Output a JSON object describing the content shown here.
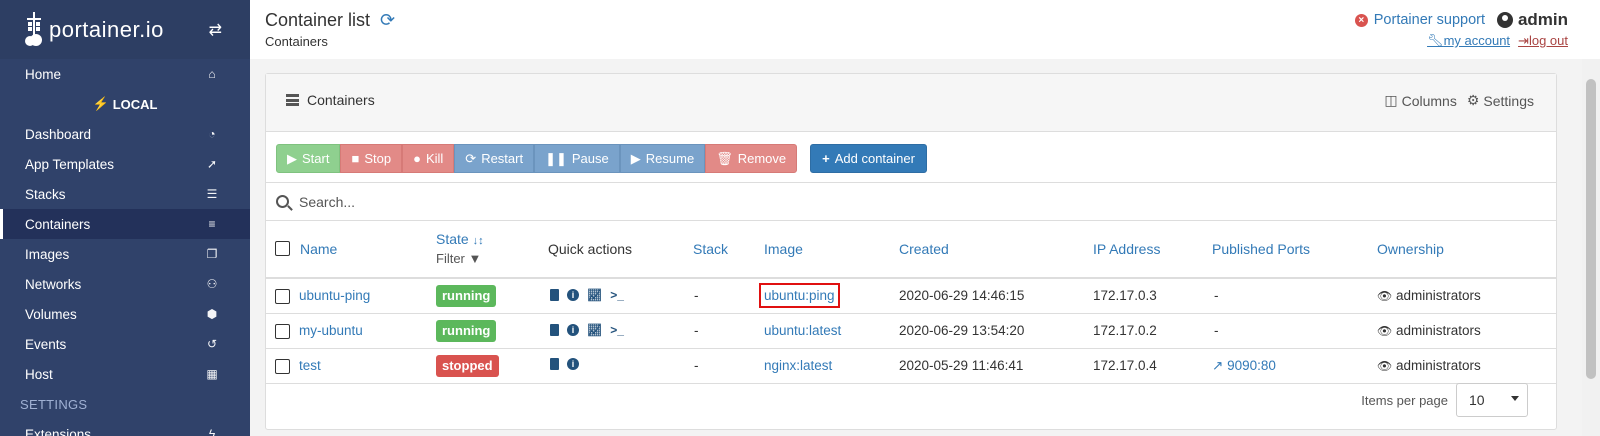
{
  "brand": {
    "name": "portainer.io"
  },
  "sidebar": {
    "items": [
      {
        "label": "Home",
        "icon": "home-icon"
      },
      {
        "label": "Dashboard",
        "icon": "tachometer-icon"
      },
      {
        "label": "App Templates",
        "icon": "rocket-icon"
      },
      {
        "label": "Stacks",
        "icon": "th-list-icon"
      },
      {
        "label": "Containers",
        "icon": "server-icon"
      },
      {
        "label": "Images",
        "icon": "clone-icon"
      },
      {
        "label": "Networks",
        "icon": "sitemap-icon"
      },
      {
        "label": "Volumes",
        "icon": "cubes-icon"
      },
      {
        "label": "Events",
        "icon": "history-icon"
      },
      {
        "label": "Host",
        "icon": "th-icon"
      },
      {
        "label": "Extensions",
        "icon": "bolt-icon"
      }
    ],
    "endpoint": "LOCAL",
    "settings_section": "SETTINGS"
  },
  "header": {
    "title": "Container list",
    "breadcrumb": "Containers",
    "support": "Portainer support",
    "username": "admin",
    "my_account": "my account",
    "logout": "log out"
  },
  "widget": {
    "title": "Containers",
    "columns_label": "Columns",
    "settings_label": "Settings"
  },
  "toolbar": {
    "start": "Start",
    "stop": "Stop",
    "kill": "Kill",
    "restart": "Restart",
    "pause": "Pause",
    "resume": "Resume",
    "remove": "Remove",
    "add": "Add container"
  },
  "search": {
    "placeholder": "Search..."
  },
  "table": {
    "headers": {
      "name": "Name",
      "state": "State",
      "filter": "Filter",
      "quick_actions": "Quick actions",
      "stack": "Stack",
      "image": "Image",
      "created": "Created",
      "ip": "IP Address",
      "ports": "Published Ports",
      "ownership": "Ownership"
    },
    "rows": [
      {
        "name": "ubuntu-ping",
        "state": "running",
        "stack": "-",
        "image": "ubuntu:ping",
        "created": "2020-06-29 14:46:15",
        "ip": "172.17.0.3",
        "ports": "-",
        "ownership": "administrators"
      },
      {
        "name": "my-ubuntu",
        "state": "running",
        "stack": "-",
        "image": "ubuntu:latest",
        "created": "2020-06-29 13:54:20",
        "ip": "172.17.0.2",
        "ports": "-",
        "ownership": "administrators"
      },
      {
        "name": "test",
        "state": "stopped",
        "stack": "-",
        "image": "nginx:latest",
        "created": "2020-05-29 11:46:41",
        "ip": "172.17.0.4",
        "ports": "9090:80",
        "ownership": "administrators"
      }
    ]
  },
  "pager": {
    "label": "Items per page",
    "value": "10"
  },
  "colors": {
    "sidebar": "#30426a",
    "link": "#337ab7",
    "running": "#5cb85c",
    "stopped": "#d9534f"
  }
}
